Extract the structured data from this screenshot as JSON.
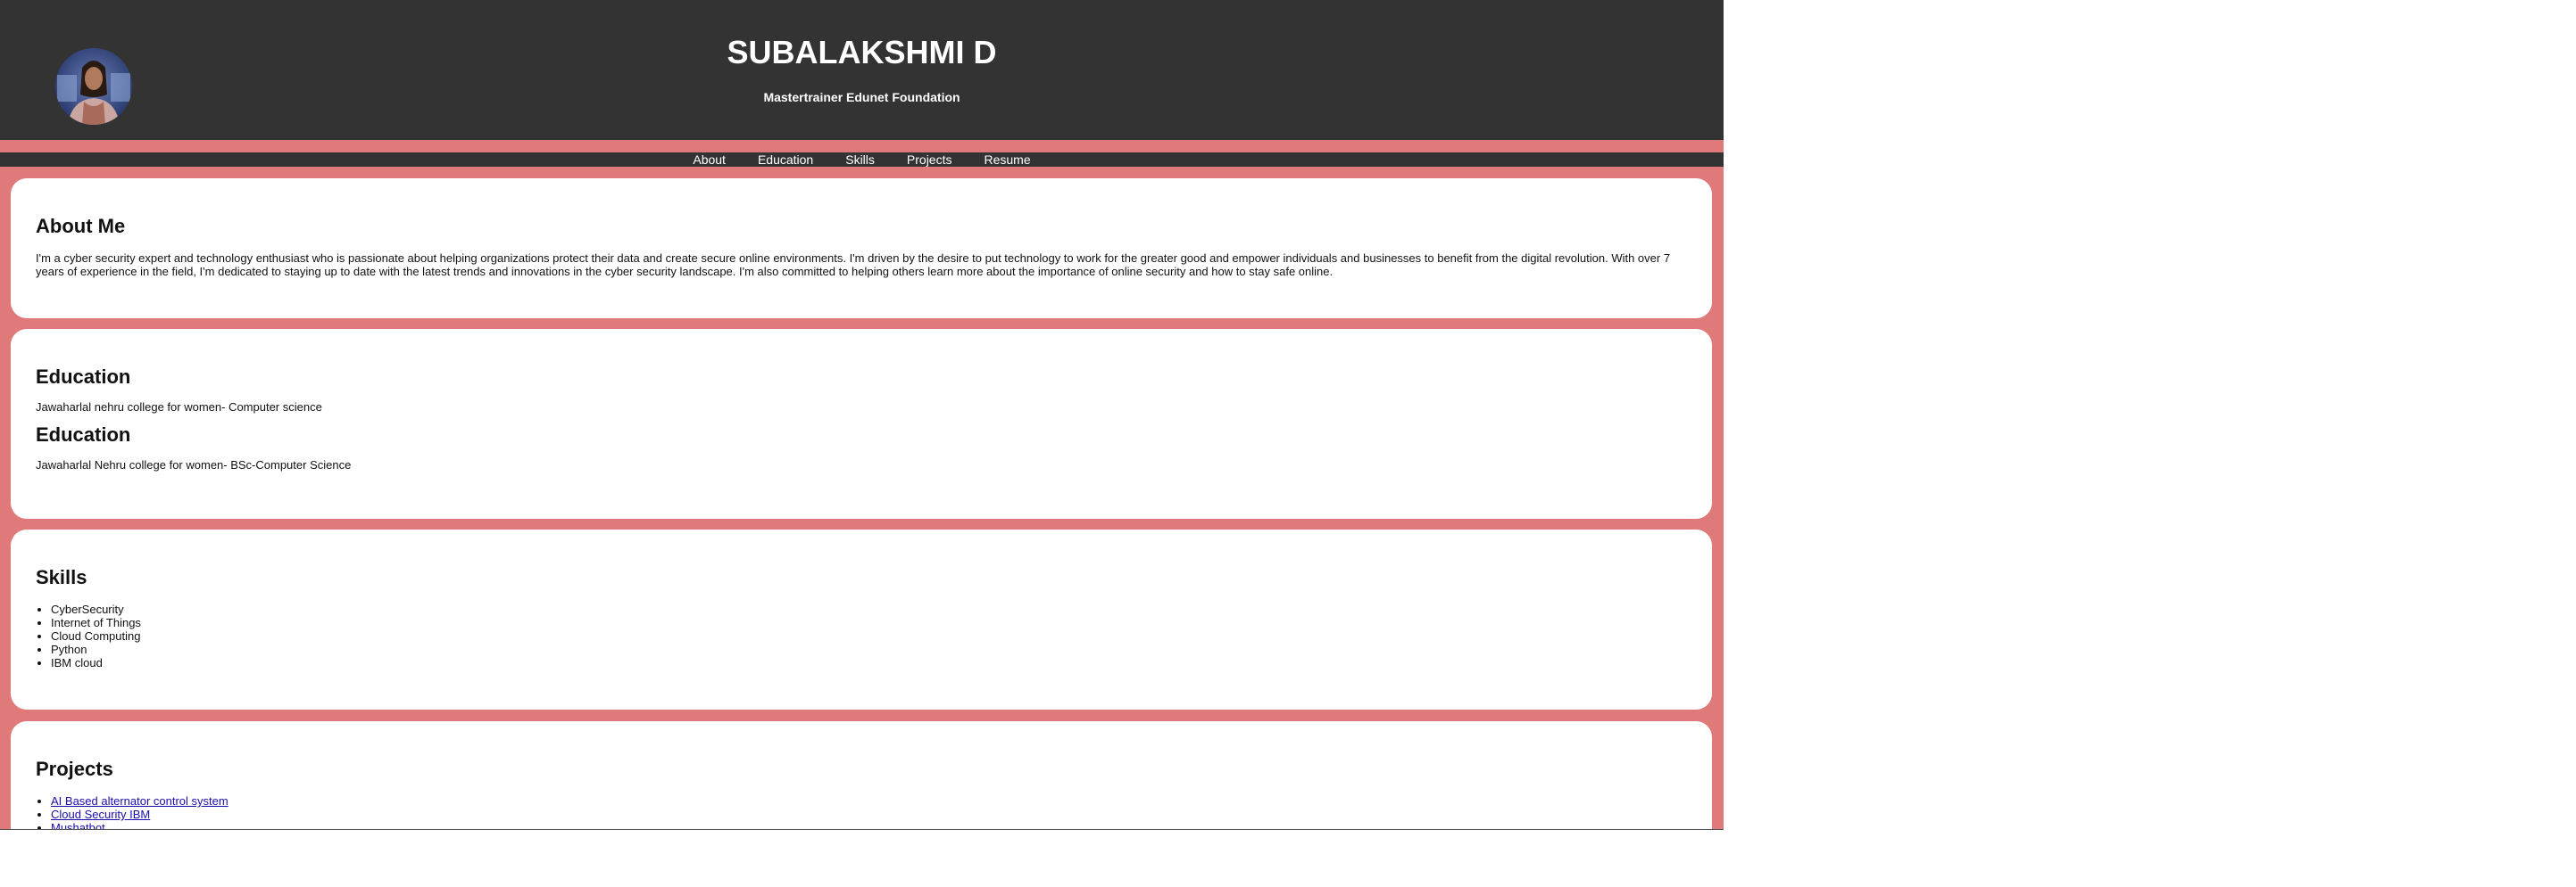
{
  "header": {
    "name": "SUBALAKSHMI D",
    "subtitle": "Mastertrainer Edunet Foundation"
  },
  "nav": {
    "items": [
      "About",
      "Education",
      "Skills",
      "Projects",
      "Resume"
    ]
  },
  "about": {
    "heading": "About Me",
    "text": "I'm a cyber security expert and technology enthusiast who is passionate about helping organizations protect their data and create secure online environments. I'm driven by the desire to put technology to work for the greater good and empower individuals and businesses to benefit from the digital revolution. With over 7 years of experience in the field, I'm dedicated to staying up to date with the latest trends and innovations in the cyber security landscape. I'm also committed to helping others learn more about the importance of online security and how to stay safe online."
  },
  "education": [
    {
      "heading": "Education",
      "text": "Jawaharlal nehru college for women- Computer science"
    },
    {
      "heading": "Education",
      "text": "Jawaharlal Nehru college for women- BSc-Computer Science"
    }
  ],
  "skills": {
    "heading": "Skills",
    "items": [
      "CyberSecurity",
      "Internet of Things",
      "Cloud Computing",
      "Python",
      "IBM cloud"
    ]
  },
  "projects": {
    "heading": "Projects",
    "items": [
      "AI Based alternator control system",
      "Cloud Security IBM",
      "Mushatbot"
    ]
  },
  "colors": {
    "header_bg": "#333333",
    "page_bg": "#e07a7a",
    "card_bg": "#ffffff",
    "link": "#1a0dab"
  },
  "icons": {
    "avatar": "profile-photo"
  }
}
